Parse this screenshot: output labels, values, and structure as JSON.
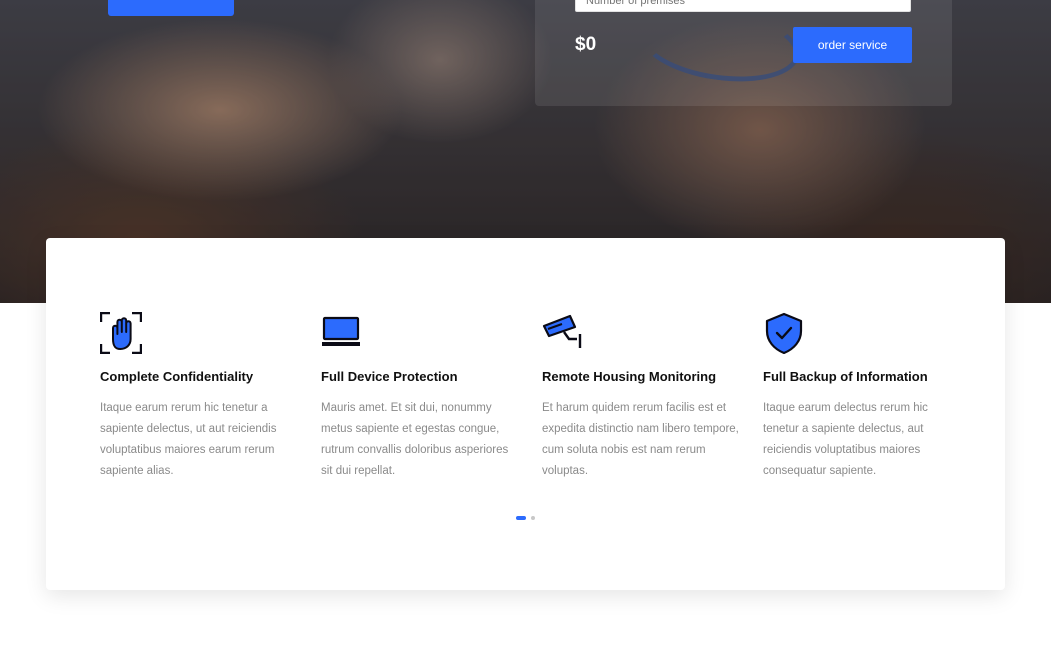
{
  "order_form": {
    "premises_placeholder": "Number of premises",
    "price": "$0",
    "order_label": "order service"
  },
  "features": [
    {
      "icon": "hand-scan-icon",
      "title": "Complete Confidentiality",
      "text": "Itaque earum rerum hic tenetur a sapiente delectus, ut aut reiciendis voluptatibus maiores earum rerum sapiente alias."
    },
    {
      "icon": "laptop-icon",
      "title": "Full Device Protection",
      "text": "Mauris amet. Et sit dui, nonummy metus sapiente et egestas congue, rutrum convallis doloribus asperiores sit dui repellat."
    },
    {
      "icon": "security-camera-icon",
      "title": "Remote Housing Monitoring",
      "text": "Et harum quidem rerum facilis est et expedita distinctio nam libero tempore, cum soluta nobis est nam rerum voluptas."
    },
    {
      "icon": "shield-check-icon",
      "title": "Full Backup of Information",
      "text": "Itaque earum delectus rerum hic tenetur a sapiente delectus, aut reiciendis voluptatibus maiores consequatur sapiente."
    }
  ],
  "carousel": {
    "pages": 2,
    "active": 1
  },
  "colors": {
    "accent": "#2c6bfd",
    "title": "#101010",
    "body_text": "#8a8a8a",
    "icon_stroke": "#0b0b16"
  }
}
